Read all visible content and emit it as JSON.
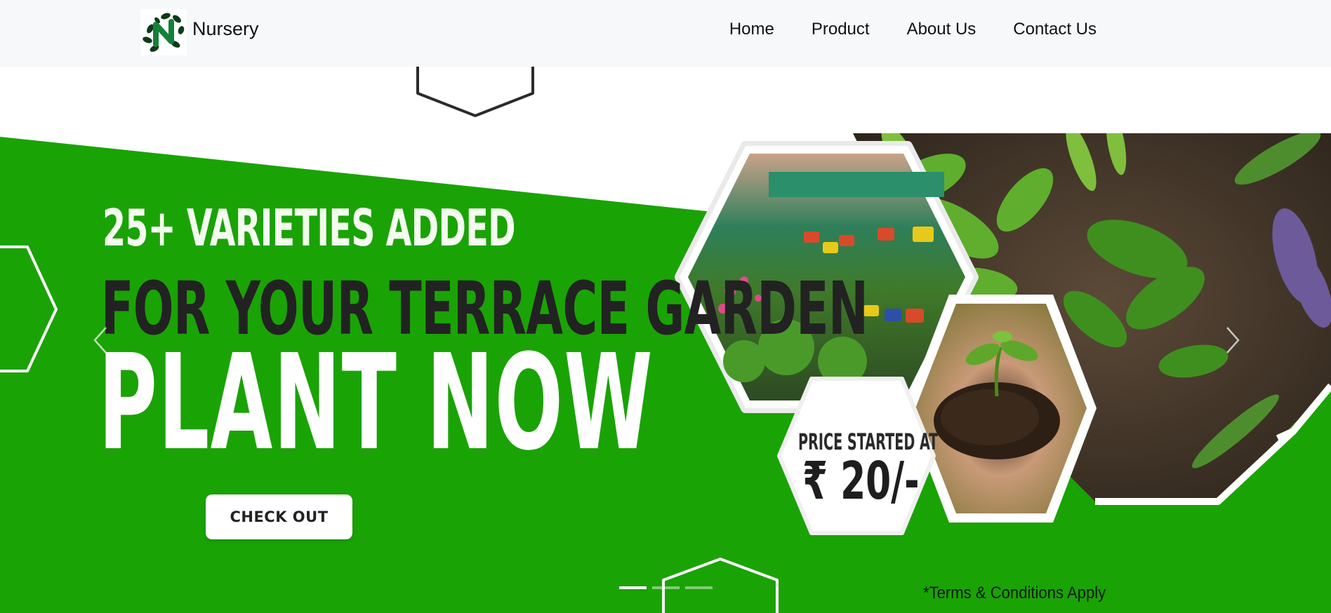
{
  "navbar": {
    "brand_name": "Nursery",
    "links": [
      "Home",
      "Product",
      "About Us",
      "Contact Us"
    ]
  },
  "hero": {
    "headline_1": "25+ VARIETIES ADDED",
    "headline_2": "FOR YOUR TERRACE GARDEN",
    "headline_3": "PLANT NOW",
    "cta_label": "CHECK OUT",
    "price_label": "PRICE STARTED AT",
    "price_value": "₹ 20/-",
    "terms": "*Terms & Conditions Apply",
    "active_slide": 1,
    "slide_count": 3
  },
  "colors": {
    "brand_green": "#1aa305",
    "navbar_bg": "#f7f8fa",
    "text_dark": "#222222"
  },
  "icons": {
    "logo": "leaf-n-logo-icon",
    "prev": "chevron-left-icon",
    "next": "chevron-right-icon"
  }
}
